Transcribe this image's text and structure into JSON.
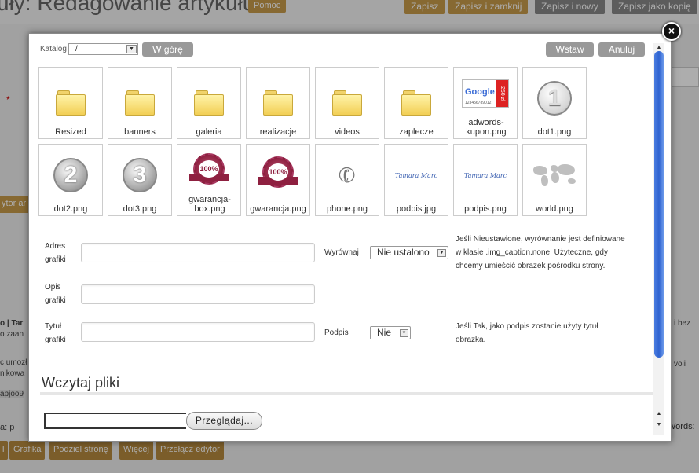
{
  "background": {
    "page_title": "uły: Redagowanie artykułu",
    "help_button": "Pomoc",
    "toolbar": [
      "Zapisz",
      "Zapisz i zamknij",
      "Zapisz i nowy",
      "Zapisz jako kopię"
    ],
    "editor_tab": "ytor ar",
    "side_texts": [
      "o | Tar",
      "o zaan",
      "c umozł",
      "nikowa",
      "apjoo9",
      "a: p",
      "i bez",
      "voli"
    ],
    "bottom_buttons": [
      "l",
      "Grafika",
      "Podziel stronę",
      "Więcej",
      "Przełącz edytor"
    ],
    "words_label": "Words:"
  },
  "modal": {
    "close_icon": "×",
    "directory_label": "Katalog",
    "directory_value": "/",
    "up_button": "W górę",
    "insert_button": "Wstaw",
    "cancel_button": "Anuluj",
    "items": [
      {
        "label": "Resized",
        "icon": "folder-icon"
      },
      {
        "label": "banners",
        "icon": "folder-icon"
      },
      {
        "label": "galeria",
        "icon": "folder-icon"
      },
      {
        "label": "realizacje",
        "icon": "folder-icon"
      },
      {
        "label": "videos",
        "icon": "folder-icon"
      },
      {
        "label": "zaplecze",
        "icon": "folder-icon"
      },
      {
        "label": "adwords-kupon.png",
        "icon": "coupon-thumbnail"
      },
      {
        "label": "dot1.png",
        "icon": "number-1-thumbnail"
      },
      {
        "label": "dot2.png",
        "icon": "number-2-thumbnail"
      },
      {
        "label": "dot3.png",
        "icon": "number-3-thumbnail"
      },
      {
        "label": "gwarancja-box.png",
        "icon": "seal-thumbnail"
      },
      {
        "label": "gwarancja.png",
        "icon": "seal-thumbnail"
      },
      {
        "label": "phone.png",
        "icon": "phone-thumbnail"
      },
      {
        "label": "podpis.jpg",
        "icon": "signature-thumbnail"
      },
      {
        "label": "podpis.png",
        "icon": "signature-thumbnail"
      },
      {
        "label": "world.png",
        "icon": "world-map-thumbnail"
      }
    ],
    "thumb_text": {
      "coupon_brand": "Google",
      "coupon_value": "250 zł",
      "coupon_number": "123456789012",
      "dot1": "1",
      "dot2": "2",
      "dot3": "3",
      "seal": "100%",
      "signature": "Tamara Marc"
    },
    "form": {
      "image_address_label_1": "Adres",
      "image_address_label_2": "grafiki",
      "image_address_value": "",
      "description_label_1": "Opis",
      "description_label_2": "grafiki",
      "description_value": "",
      "title_label_1": "Tytuł",
      "title_label_2": "grafiki",
      "title_value": "",
      "align_label": "Wyrównaj",
      "align_value": "Nie ustalono",
      "align_hint_lines": [
        "Jeśli Nieustawione, wyrównanie jest definiowane",
        "w klasie .img_caption.none. Użyteczne, gdy",
        "chcemy umieścić obrazek pośrodku strony."
      ],
      "caption_label": "Podpis",
      "caption_value": "Nie",
      "caption_hint_lines": [
        "Jeśli Tak, jako podpis zostanie użyty tytuł",
        "obrazka."
      ]
    },
    "upload": {
      "title": "Wczytaj pliki",
      "file_value": "",
      "browse_button": "Przeglądaj..."
    }
  }
}
